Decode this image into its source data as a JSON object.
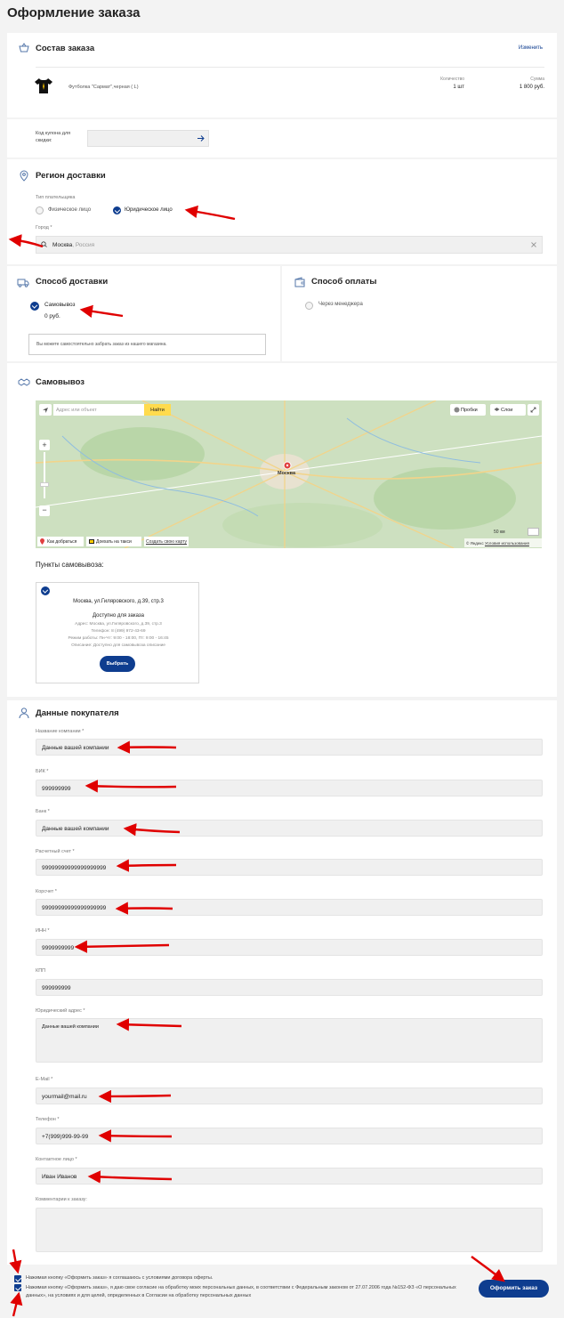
{
  "page": {
    "title": "Оформление заказа"
  },
  "order": {
    "title": "Состав заказа",
    "edit_link": "Изменить",
    "item_name": "Футболка \"Сармат\",черная ( L)",
    "qty_header": "Количество",
    "qty_value": "1 шт",
    "sum_header": "Сумма",
    "sum_value": "1 800 руб."
  },
  "coupon": {
    "label": "Код купона для скидки:",
    "value": ""
  },
  "region": {
    "title": "Регион доставки",
    "payer_type_label": "Тип плательщика",
    "payer_individual": "Физическое лицо",
    "payer_legal": "Юридическое лицо",
    "city_label": "Город *",
    "city_value": "Москва",
    "city_country": ", Россия"
  },
  "delivery": {
    "title": "Способ доставки",
    "option": "Самовывоз",
    "price": "0 руб.",
    "note": "Вы можете самостоятельно забрать заказ из нашего магазина."
  },
  "payment": {
    "title": "Способ оплаты",
    "option": "Через менеджера"
  },
  "pickup": {
    "title": "Самовывоз",
    "map_search_placeholder": "Адрес или объект",
    "map_find": "Найти",
    "map_traffic": "Пробки",
    "map_layers": "Слои",
    "map_route": "Как добраться",
    "map_taxi": "Доехать на такси",
    "map_make": "Создать свою карту",
    "map_scale": "50 км",
    "map_copyright": "© Яндекс",
    "map_terms": "Условия использования",
    "map_city_label": "Москва",
    "points_title": "Пункты самовывоза:",
    "point_name": "Москва, ул.Гиляровского, д.39, стр.3",
    "point_status": "Доступно для заказа",
    "point_address": "Адрес: Москва, ул.Гиляровского, д.39, стр.3",
    "point_phone": "Телефон: 8 (499) 972-43-69",
    "point_hours": "Режим работы: Пн-Чт: 9:00 - 18:00, Пт: 9:00 - 16:45",
    "point_desc": "Описание: Доступно для самовывоза описание",
    "choose_button": "Выбрать"
  },
  "buyer": {
    "title": "Данные покупателя",
    "fields": [
      {
        "label": "Название компании *",
        "value": "Данные вашей компании"
      },
      {
        "label": "БИК *",
        "value": "999999999"
      },
      {
        "label": "Банк *",
        "value": "Данные вашей компании"
      },
      {
        "label": "Расчетный счет *",
        "value": "99999999999999999999"
      },
      {
        "label": "Корсчет *",
        "value": "99999999999999999999"
      },
      {
        "label": "ИНН *",
        "value": "9999999999"
      },
      {
        "label": "КПП",
        "value": "999999999"
      },
      {
        "label": "Юридический адрес *",
        "value": "Данные вашей компании"
      },
      {
        "label": "E-Mail *",
        "value": "yourmail@mail.ru"
      },
      {
        "label": "Телефон *",
        "value": "+7(999)999-99-99"
      },
      {
        "label": "Контактное лицо *",
        "value": "Иван Иванов"
      },
      {
        "label": "Комментарии к заказу:",
        "value": ""
      }
    ]
  },
  "consent": {
    "offer": "Нажимая кнопку «Оформить заказ» я соглашаюсь с условиями договора оферты.",
    "personal": "Нажимая кнопку «Оформить заказ», я даю свое согласие на обработку моих персональных данных, в соответствии с Федеральным законом от 27.07.2006 года №152-ФЗ «О персональных данных», на условиях и для целей, определенных в Согласии на обработку персональных данных"
  },
  "submit": {
    "label": "Оформить заказ"
  },
  "colors": {
    "accent": "#0e3d8f",
    "arrow": "#e00000",
    "map_button": "#ffdb4d"
  }
}
